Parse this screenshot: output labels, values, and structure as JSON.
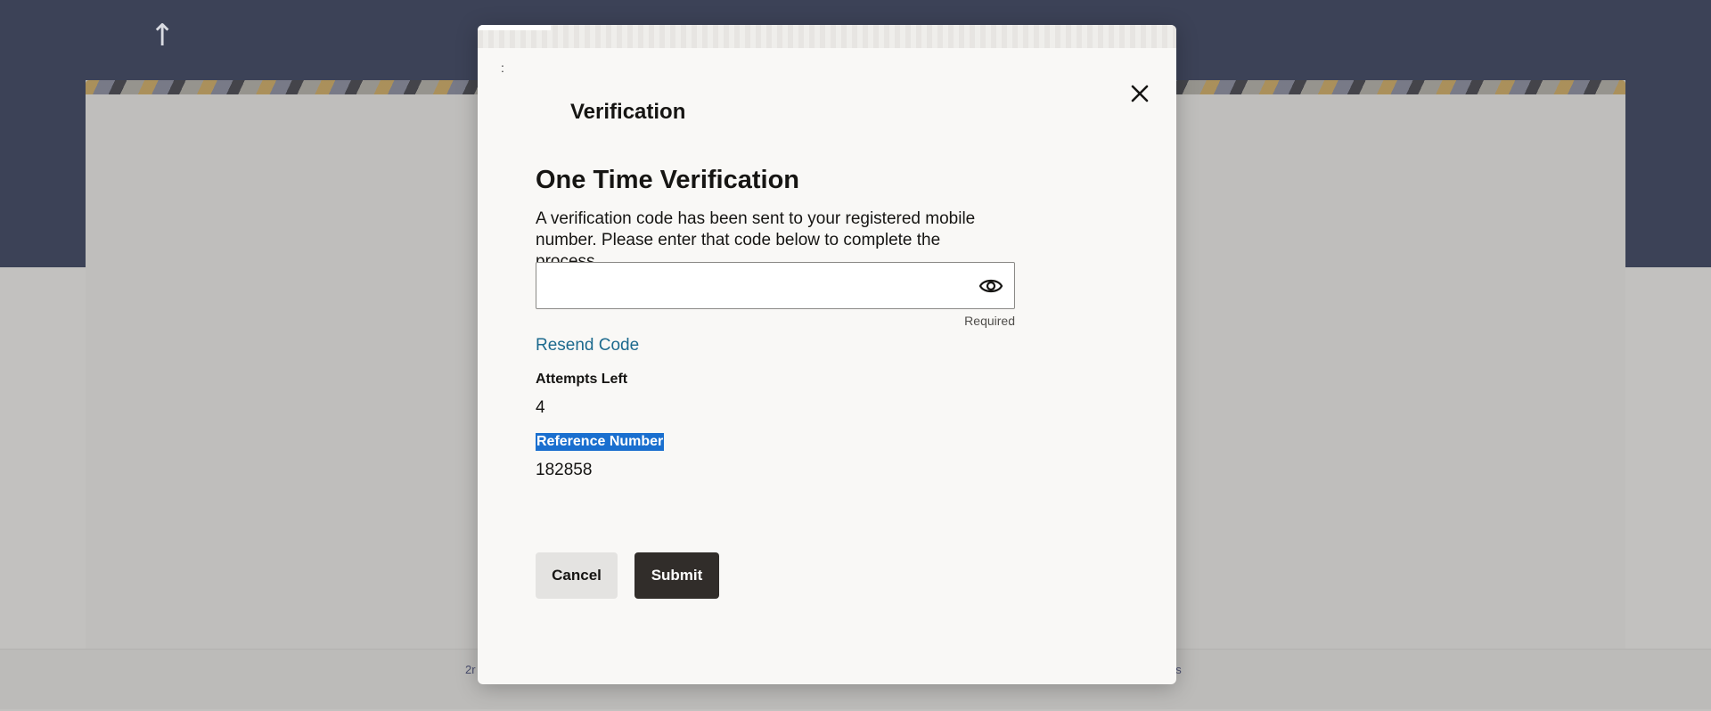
{
  "background": {
    "up_arrow_glyph": "↑",
    "footer_left_text": "2r",
    "footer_right_text": "ns"
  },
  "modal": {
    "dots": ":",
    "title": "Verification",
    "close_glyph": "close-icon",
    "heading": "One Time Verification",
    "description": "A verification code has been sent to your registered mobile number. Please enter that code below to complete the process.",
    "otp_input": {
      "value": "",
      "placeholder": "",
      "helper": "Required"
    },
    "resend_label": "Resend Code",
    "attempts_label": "Attempts Left",
    "attempts_value": "4",
    "reference_label": "Reference Number",
    "reference_value": "182858",
    "cancel_label": "Cancel",
    "submit_label": "Submit"
  },
  "colors": {
    "header_bg": "#3c4257",
    "modal_bg": "#f9f8f6",
    "link": "#1d6a8e",
    "primary_button": "#312d2a",
    "selection": "#1a6fcf"
  }
}
